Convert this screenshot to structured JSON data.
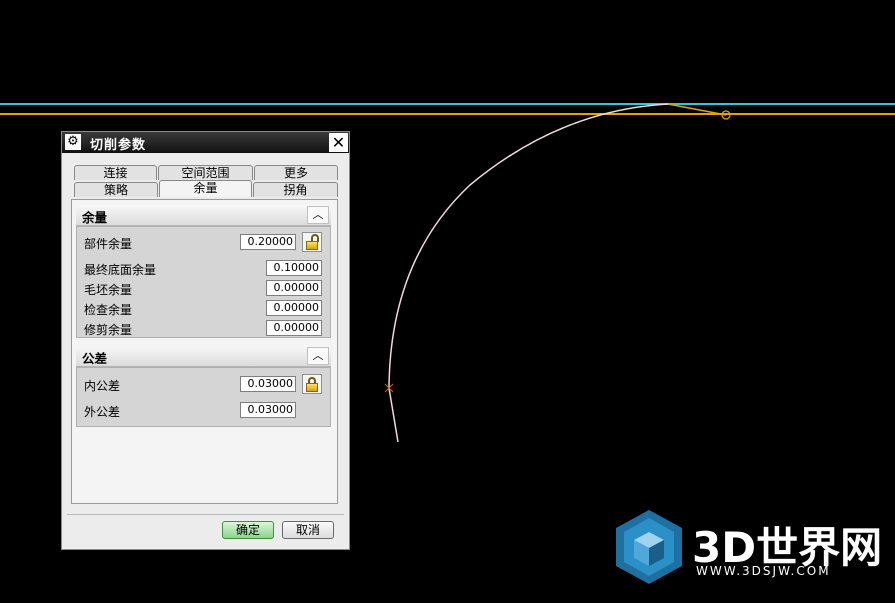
{
  "dialog": {
    "title": "切削参数",
    "tabs_row1": [
      {
        "label": "连接"
      },
      {
        "label": "空间范围"
      },
      {
        "label": "更多"
      }
    ],
    "tabs_row2": [
      {
        "label": "策略"
      },
      {
        "label": "余量",
        "active": true
      },
      {
        "label": "拐角"
      }
    ],
    "group_allowance": {
      "title": "余量",
      "fields": [
        {
          "label": "部件余量",
          "value": "0.20000",
          "locked": false
        },
        {
          "label": "最终底面余量",
          "value": "0.10000"
        },
        {
          "label": "毛坯余量",
          "value": "0.00000"
        },
        {
          "label": "检查余量",
          "value": "0.00000"
        },
        {
          "label": "修剪余量",
          "value": "0.00000"
        }
      ]
    },
    "group_tolerance": {
      "title": "公差",
      "fields": [
        {
          "label": "内公差",
          "value": "0.03000",
          "locked": true
        },
        {
          "label": "外公差",
          "value": "0.03000"
        }
      ]
    },
    "ok_label": "确定",
    "cancel_label": "取消"
  },
  "colors": {
    "background": "#000000",
    "cyan_line": "#2fc8dc",
    "orange_line": "#e6a300",
    "arc": "#f0d8dc",
    "marker": "#e06020"
  },
  "watermark": {
    "brand": "3D世界网",
    "url": "WWW.3DSJW.COM"
  }
}
